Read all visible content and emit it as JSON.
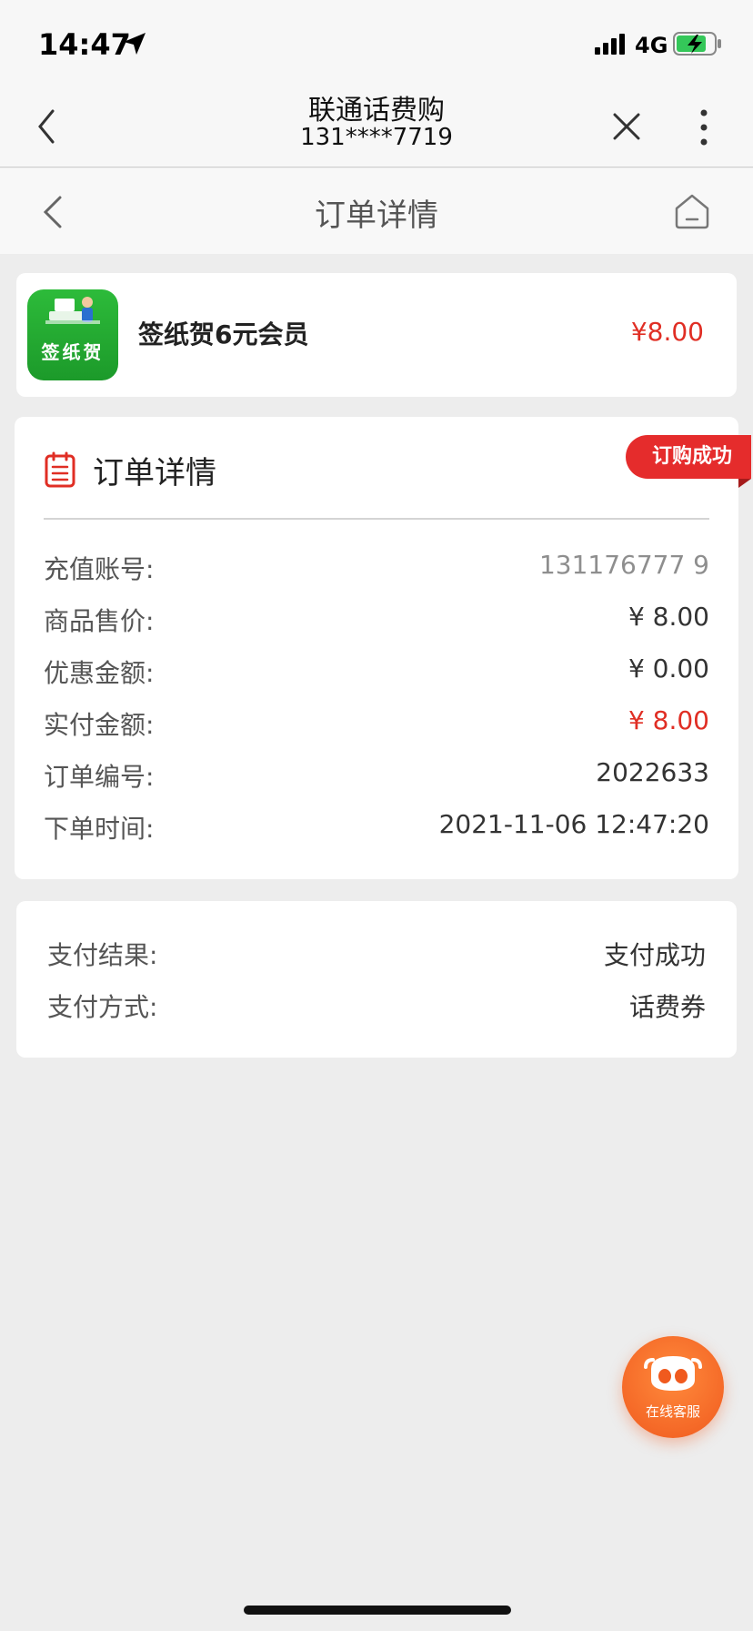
{
  "status_bar": {
    "time": "14:47",
    "network": "4G",
    "battery_color": "#34c759"
  },
  "header": {
    "title": "联通话费购",
    "subtitle": "131****7719"
  },
  "nav": {
    "title": "订单详情"
  },
  "product": {
    "logo_text": "签纸贺",
    "name": "签纸贺6元会员",
    "price": "¥8.00"
  },
  "order": {
    "heading": "订单详情",
    "badge": "订购成功",
    "rows": [
      {
        "label": "充值账号:",
        "value": "131176777 9"
      },
      {
        "label": "商品售价:",
        "value": "¥ 8.00"
      },
      {
        "label": "优惠金额:",
        "value": "¥ 0.00"
      },
      {
        "label": "实付金额:",
        "value": "¥ 8.00"
      },
      {
        "label": "订单编号:",
        "value": "2022633"
      },
      {
        "label": "下单时间:",
        "value": "2021-11-06 12:47:20"
      }
    ]
  },
  "payment": {
    "rows": [
      {
        "label": "支付结果:",
        "value": "支付成功"
      },
      {
        "label": "支付方式:",
        "value": "话费券"
      }
    ]
  },
  "service": {
    "label": "在线客服"
  },
  "colors": {
    "accent_red": "#e02e24",
    "service_orange": "#f05a1e",
    "logo_green": "#2dbb3a"
  }
}
